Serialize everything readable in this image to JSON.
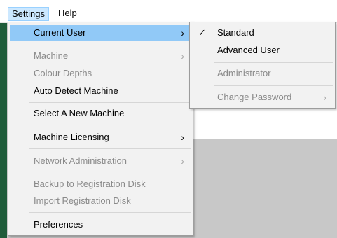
{
  "menubar": {
    "settings": "Settings",
    "help": "Help"
  },
  "settings_menu": {
    "current_user": "Current User",
    "machine": "Machine",
    "colour_depths": "Colour Depths",
    "auto_detect_machine": "Auto Detect Machine",
    "select_new_machine": "Select A New Machine",
    "machine_licensing": "Machine Licensing",
    "network_administration": "Network Administration",
    "backup_registration": "Backup to Registration Disk",
    "import_registration": "Import Registration Disk",
    "preferences": "Preferences",
    "arrow": "›"
  },
  "user_submenu": {
    "standard": "Standard",
    "advanced_user": "Advanced User",
    "administrator": "Administrator",
    "change_password": "Change Password",
    "check": "✓",
    "arrow": "›"
  },
  "colors": {
    "highlight": "#91c9f7",
    "menubar_active": "#cce8ff",
    "disabled_text": "#8a8a8a"
  }
}
